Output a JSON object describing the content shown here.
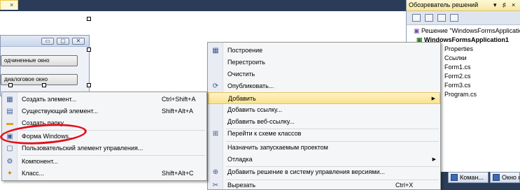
{
  "designer": {
    "tab_label": "×",
    "form": {
      "title_buttons": [
        "▭",
        "▢",
        "✕"
      ],
      "button1": "одчиненные окно",
      "button2": "диалоговое окно"
    }
  },
  "context_menu": {
    "items": [
      {
        "label": "Построение",
        "icon": "build-icon",
        "glyph": "▦"
      },
      {
        "label": "Перестроить",
        "icon": "",
        "glyph": ""
      },
      {
        "label": "Очистить",
        "icon": "",
        "glyph": ""
      },
      {
        "label": "Опубликовать...",
        "icon": "publish-icon",
        "glyph": "⟳"
      },
      {
        "label": "Добавить",
        "icon": "",
        "glyph": "",
        "submenu": true,
        "highlighted": true
      },
      {
        "label": "Добавить ссылку...",
        "icon": "",
        "glyph": ""
      },
      {
        "label": "Добавить веб-ссылку...",
        "icon": "",
        "glyph": ""
      },
      {
        "label": "Перейти к схеме классов",
        "icon": "class-diagram-icon",
        "glyph": "⊞"
      },
      {
        "label": "Назначить запускаемым проектом",
        "icon": "",
        "glyph": ""
      },
      {
        "label": "Отладка",
        "icon": "",
        "glyph": "",
        "submenu": true
      },
      {
        "label": "Добавить решение в систему управления версиями...",
        "icon": "source-control-icon",
        "glyph": "⊕"
      },
      {
        "label": "Вырезать",
        "icon": "cut-icon",
        "glyph": "✂",
        "shortcut": "Ctrl+X"
      }
    ],
    "submenu_arrow": "▶"
  },
  "add_submenu": {
    "items": [
      {
        "label": "Создать элемент...",
        "shortcut": "Ctrl+Shift+A",
        "icon": "new-item-icon",
        "glyph": "▦"
      },
      {
        "label": "Существующий элемент...",
        "shortcut": "Shift+Alt+A",
        "icon": "existing-item-icon",
        "glyph": "▤"
      },
      {
        "label": "Создать папку",
        "shortcut": "",
        "icon": "folder-icon",
        "glyph": "▬"
      },
      {
        "label": "Форма Windows...",
        "shortcut": "",
        "icon": "windows-form-icon",
        "glyph": "▣"
      },
      {
        "label": "Пользовательский элемент управления...",
        "shortcut": "",
        "icon": "user-control-icon",
        "glyph": "▢"
      },
      {
        "label": "Компонент...",
        "shortcut": "",
        "icon": "component-icon",
        "glyph": "⚙"
      },
      {
        "label": "Класс...",
        "shortcut": "Shift+Alt+C",
        "icon": "class-icon",
        "glyph": "✦"
      }
    ]
  },
  "solution_explorer": {
    "title": "Обозреватель решений",
    "controls": [
      "▾",
      "♯",
      "×"
    ],
    "tree": [
      {
        "label": "Решение \"WindowsFormsApplication",
        "glyph": "▣"
      },
      {
        "label": "WindowsFormsApplication1",
        "glyph": "▣",
        "selected": true
      },
      {
        "label": "Properties",
        "glyph": ""
      },
      {
        "label": "Ссылки",
        "glyph": ""
      },
      {
        "label": "Form1.cs",
        "glyph": ""
      },
      {
        "label": "Form2.cs",
        "glyph": ""
      },
      {
        "label": "Form3.cs",
        "glyph": ""
      },
      {
        "label": "Program.cs",
        "glyph": ""
      }
    ]
  },
  "bottom_tabs": [
    {
      "label": "Коман..."
    },
    {
      "label": "Окно к"
    }
  ]
}
